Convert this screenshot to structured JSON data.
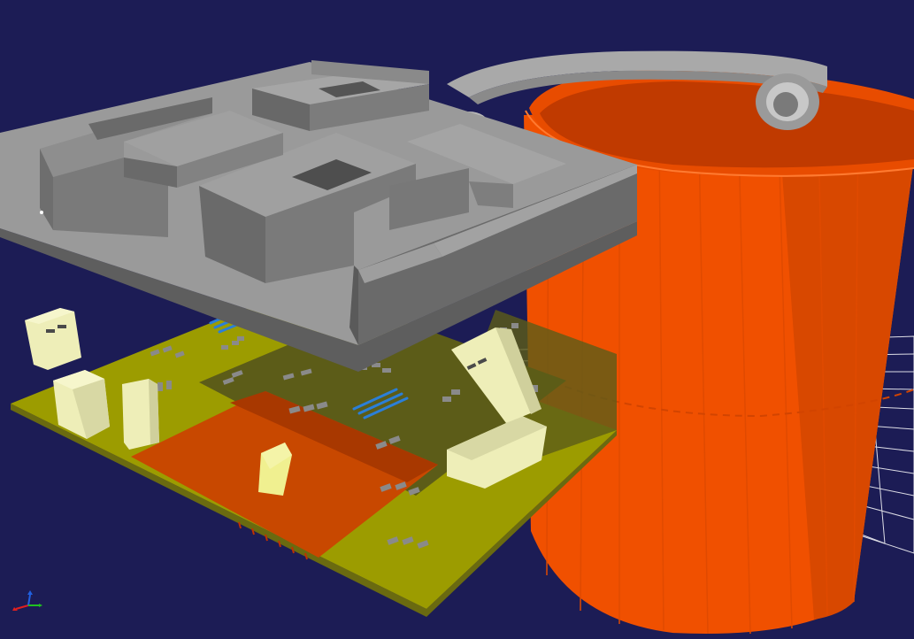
{
  "viewer": {
    "background": "#1c1c55",
    "colors": {
      "cup": "#f05000",
      "cup_dark": "#c84000",
      "cup_shadow": "#b83800",
      "maze_top": "#9a9a9a",
      "maze_side": "#6e6e6e",
      "maze_front": "#7e7e7e",
      "pcb": "#9c9c00",
      "pcb_dark": "#5a5a14",
      "pcb_copper": "#c84800",
      "component_cream": "#eeeeb8",
      "component_side": "#c8c89a",
      "smd_gray": "#8a8a8a",
      "smd_blue": "#2b7fd8",
      "grid": "#ffffff",
      "axis_x": "#e02020",
      "axis_y": "#20c020",
      "axis_z": "#2060e0"
    },
    "objects": [
      "maze-plate",
      "orange-cup",
      "cup-handle",
      "pcb-board",
      "ground-grid",
      "axis-triad"
    ]
  }
}
